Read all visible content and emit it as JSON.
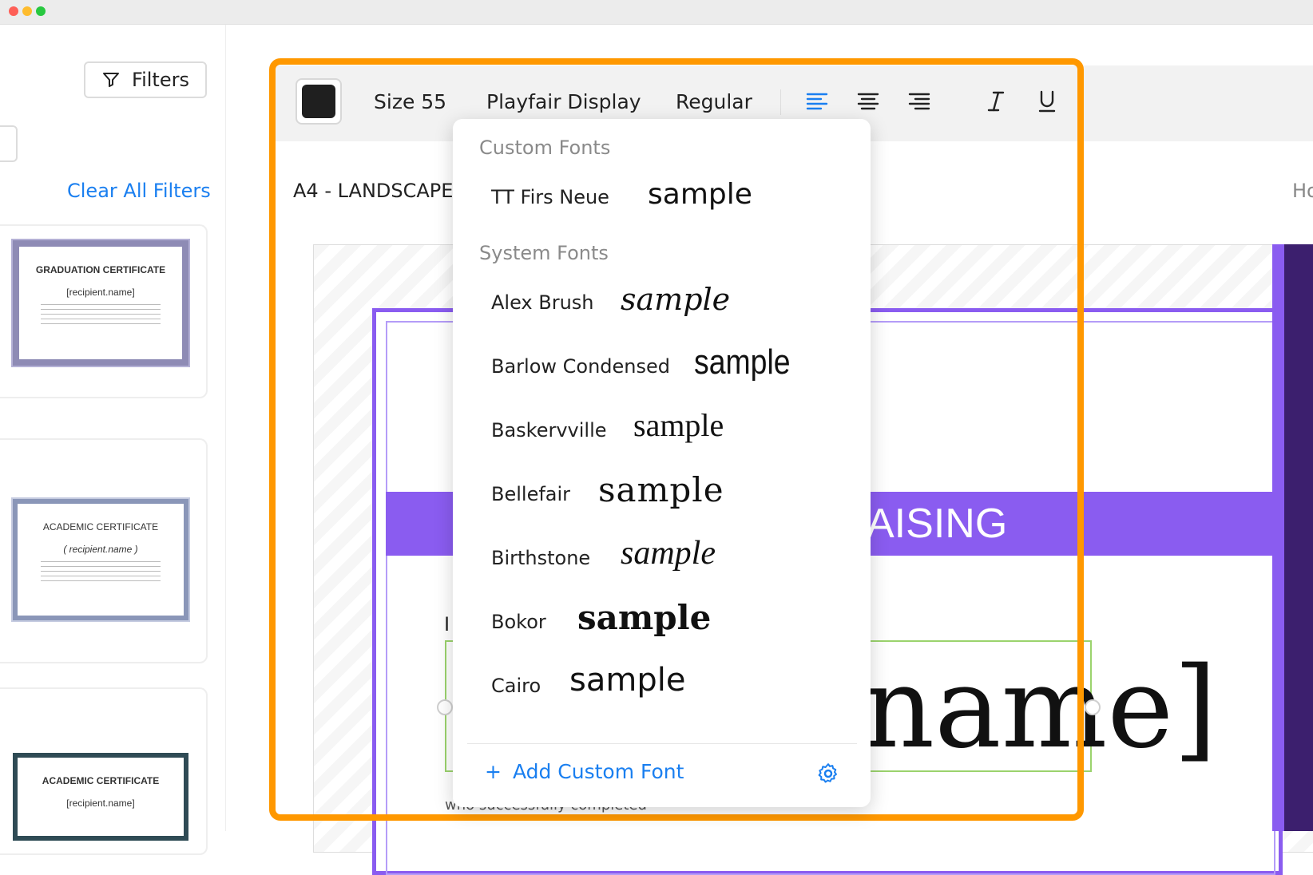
{
  "sidebar": {
    "filters_label": "Filters",
    "clear_all_label": "Clear All Filters",
    "templates": [
      {
        "title": "GRADUATION CERTIFICATE",
        "recipient": "[recipient.name]"
      },
      {
        "title": "ACADEMIC CERTIFICATE",
        "recipient": "( recipient.name )"
      },
      {
        "title": "ACADEMIC CERTIFICATE",
        "recipient": "[recipient.name]"
      }
    ]
  },
  "toolbar": {
    "color": "#1f1f1f",
    "size_label": "Size 55",
    "font_label": "Playfair Display",
    "weight_label": "Regular"
  },
  "canvas": {
    "page_label": "A4 - LANDSCAPE",
    "right_label": "Ho",
    "band_text": "AISING",
    "name_text": "name]",
    "is_text": "I",
    "bottom_text": "who successfully completed"
  },
  "font_dropdown": {
    "custom_header": "Custom Fonts",
    "system_header": "System Fonts",
    "custom_fonts": [
      {
        "name": "TT Firs Neue",
        "sample": "sample"
      }
    ],
    "system_fonts": [
      {
        "name": "Alex Brush",
        "sample": "sample"
      },
      {
        "name": "Barlow Condensed",
        "sample": "sample"
      },
      {
        "name": "Baskervville",
        "sample": "sample"
      },
      {
        "name": "Bellefair",
        "sample": "sample"
      },
      {
        "name": "Birthstone",
        "sample": "sample"
      },
      {
        "name": "Bokor",
        "sample": "sample"
      },
      {
        "name": "Cairo",
        "sample": "sample"
      }
    ],
    "add_label": "Add Custom Font",
    "add_plus": "+"
  },
  "colors": {
    "accent_blue": "#1a7ff0",
    "highlight_orange": "#ff9800",
    "certificate_purple": "#8a5cf0"
  }
}
